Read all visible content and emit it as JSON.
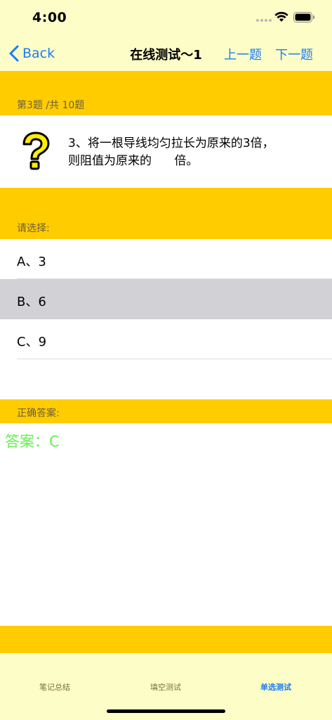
{
  "status_bar": {
    "time": "4:00"
  },
  "nav": {
    "back_label": "Back",
    "title": "在线测试～1",
    "prev_label": "上一题",
    "next_label": "下一题"
  },
  "progress": {
    "label": "第3题 /共 10题"
  },
  "question": {
    "line1": "3、将一根导线均匀拉长为原来的3倍，",
    "line2": "则阻值为原来的      倍。"
  },
  "choose": {
    "label": "请选择:"
  },
  "options": [
    {
      "label": "A、3"
    },
    {
      "label": "B、6"
    },
    {
      "label": "C、9"
    }
  ],
  "selected_option": "B、6",
  "answer": {
    "section_label": "正确答案:",
    "text": "答案：C"
  },
  "tabs": [
    {
      "label": "笔记总结"
    },
    {
      "label": "填空测试"
    },
    {
      "label": "单选测试"
    }
  ],
  "active_tab": "单选测试",
  "colors": {
    "accent": "#1a7cf6",
    "band": "#ffcc00",
    "bar_bg": "#fdfdc8",
    "answer": "#5ef54a",
    "selected_row": "#d1d1d6"
  },
  "icons": [
    "signal-icon",
    "wifi-icon",
    "battery-icon",
    "back-chevron-icon",
    "question-mark-icon"
  ]
}
